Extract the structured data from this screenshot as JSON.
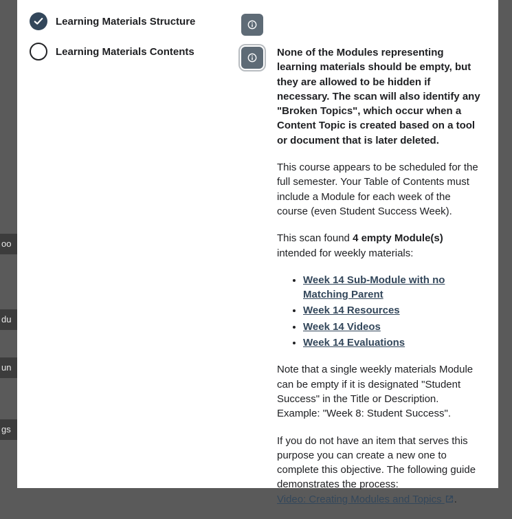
{
  "checklist": {
    "items": [
      {
        "label": "Learning Materials Structure",
        "checked": true
      },
      {
        "label": "Learning Materials Contents",
        "checked": false
      }
    ]
  },
  "info": {
    "intro_bold": "None of the Modules representing learning materials should be empty, but they are allowed to be hidden if necessary. The scan will also identify any \"Broken Topics\", which occur when a Content Topic is created based on a tool or document that is later deleted.",
    "schedule_note": "This course appears to be scheduled for the full semester. Your Table of Contents must include a Module for each week of the course (even Student Success Week).",
    "scan_prefix": "This scan found ",
    "scan_bold": "4 empty Module(s)",
    "scan_suffix": " intended for weekly materials:",
    "empty_modules": [
      "Week 14 Sub-Module with no Matching Parent",
      "Week 14 Resources",
      "Week 14 Videos",
      "Week 14 Evaluations"
    ],
    "exception_note": "Note that a single weekly materials Module can be empty if it is designated \"Student Success\" in the Title or Description. Example: \"Week 8: Student Success\".",
    "guide_intro": "If you do not have an item that serves this purpose you can create a new one to complete this objective. The following guide demonstrates the process:",
    "guide_link": "Video: Creating Modules and Topics",
    "guide_tail": "."
  }
}
